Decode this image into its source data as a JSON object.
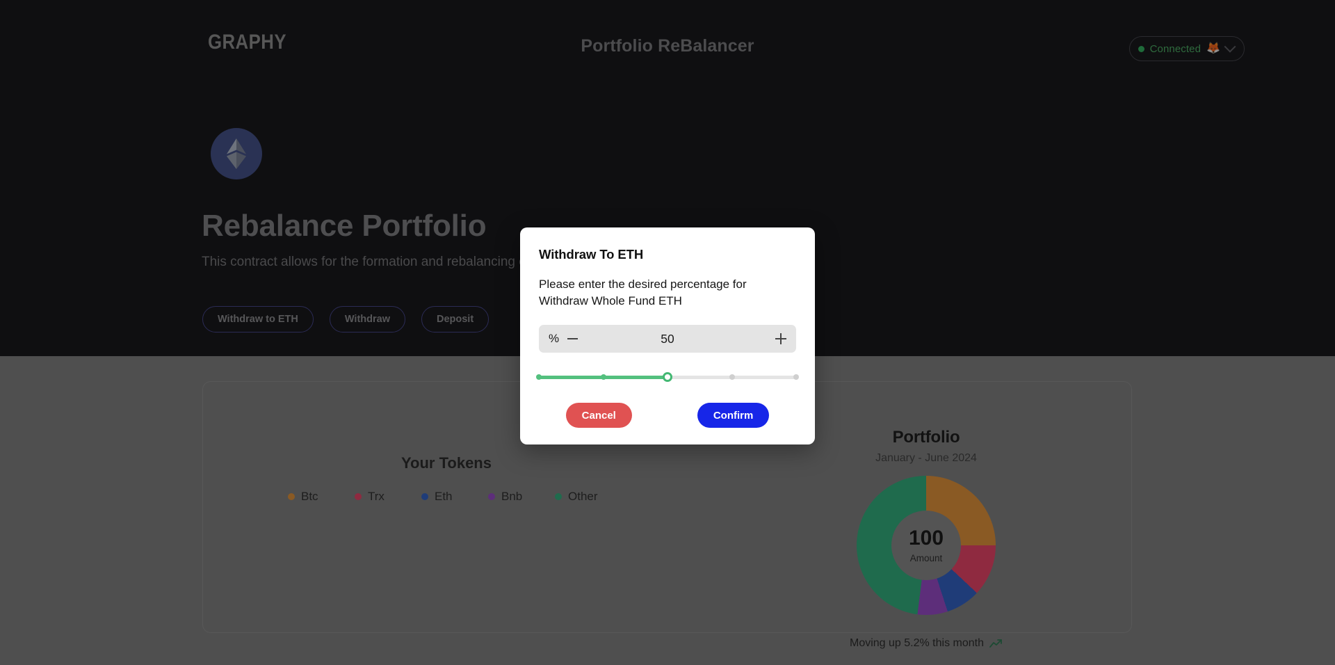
{
  "header": {
    "brand": "GRAPHY",
    "app_title": "Portfolio ReBalancer",
    "wallet": {
      "status_label": "Connected",
      "status_dot_color": "#1f6b3a",
      "wallet_icon": "metamask-fox-icon",
      "fox_glyph": "🦊",
      "chevron_icon": "chevron-down-icon"
    }
  },
  "hero": {
    "token_icon": "ethereum-icon",
    "title": "Rebalance Portfolio",
    "subtitle": "This contract allows for the formation and rebalancing of",
    "actions": [
      {
        "label": "Withdraw to ETH"
      },
      {
        "label": "Withdraw"
      },
      {
        "label": "Deposit"
      }
    ]
  },
  "panel": {
    "tokens_title": "Your Tokens",
    "portfolio_title": "Portfolio",
    "portfolio_period": "January - June 2024",
    "trend_text": "Moving up 5.2% this month",
    "trend_icon": "trending-up-icon"
  },
  "chart_data": {
    "type": "pie",
    "title": "Portfolio",
    "subtitle": "January - June 2024",
    "center_value": "100",
    "center_label": "Amount",
    "legend_position": "left",
    "categories": [
      "Btc",
      "Trx",
      "Eth",
      "Bnb",
      "Other"
    ],
    "values": [
      25,
      12,
      8,
      7,
      48
    ],
    "colors": [
      "#8a5a24",
      "#8f2a40",
      "#1f3c78",
      "#5d2e7a",
      "#1f6b4d"
    ],
    "series": [
      {
        "name": "Btc",
        "value": 25,
        "color": "#8a5a24"
      },
      {
        "name": "Trx",
        "value": 12,
        "color": "#8f2a40"
      },
      {
        "name": "Eth",
        "value": 8,
        "color": "#1f3c78"
      },
      {
        "name": "Bnb",
        "value": 7,
        "color": "#5d2e7a"
      },
      {
        "name": "Other",
        "value": 48,
        "color": "#1f6b4d"
      }
    ]
  },
  "modal": {
    "title": "Withdraw To ETH",
    "body": "Please enter the desired percentage for Withdraw Whole Fund ETH",
    "stepper": {
      "unit": "%",
      "decrement_icon": "minus-icon",
      "increment_icon": "plus-icon",
      "value": "50",
      "placeholder": "50"
    },
    "slider": {
      "value": 50,
      "min": 0,
      "max": 100,
      "marks": [
        0,
        25,
        50,
        75,
        100
      ],
      "fill_color": "#53c07e",
      "track_color": "#e4e4e4"
    },
    "cancel_label": "Cancel",
    "confirm_label": "Confirm",
    "cancel_color": "#e05252",
    "confirm_color": "#1726e8"
  }
}
